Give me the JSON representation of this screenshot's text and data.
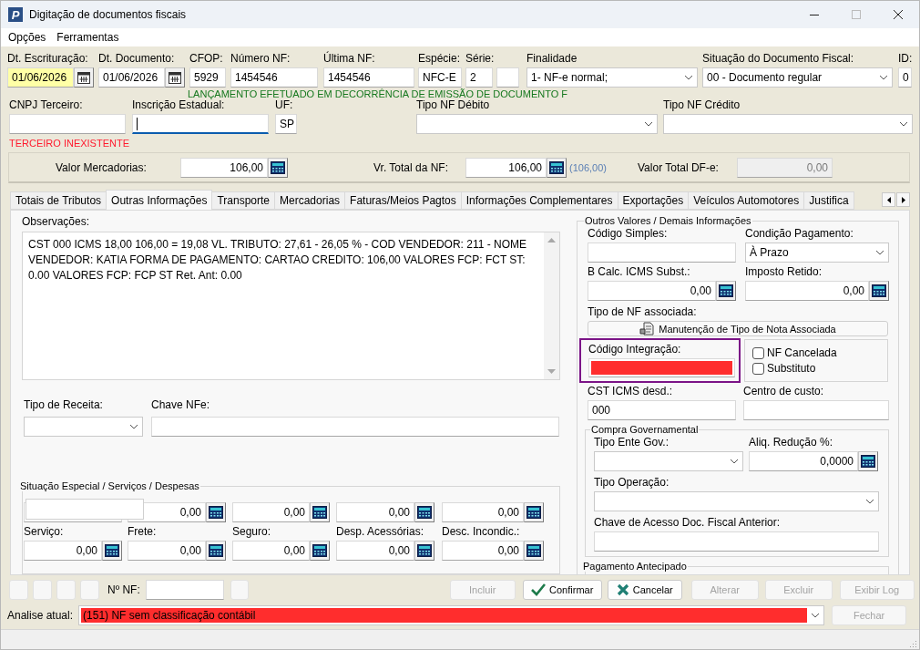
{
  "window": {
    "title": "Digitação de documentos fiscais",
    "logo": "P"
  },
  "menu": [
    {
      "label": "Opções"
    },
    {
      "label": "Ferramentas"
    }
  ],
  "header": [
    {
      "label": "Dt. Escrituração:",
      "value": "01/06/2026",
      "kind": "date",
      "highlighted": true
    },
    {
      "label": "Dt. Documento:",
      "value": "01/06/2026",
      "kind": "date",
      "highlighted": false
    },
    {
      "label": "CFOP:",
      "value": "5929",
      "kind": "text"
    },
    {
      "label": "Número NF:",
      "value": "1454546",
      "kind": "text"
    },
    {
      "label": "Última NF:",
      "value": "1454546",
      "kind": "text"
    },
    {
      "label": "Espécie:",
      "value": "NFC-E",
      "kind": "text"
    },
    {
      "label": "Série:",
      "value": "2",
      "kind": "text"
    },
    {
      "kind": "text"
    },
    {
      "label": "Finalidade",
      "value": "1- NF-e normal;",
      "kind": "select"
    },
    {
      "label": "Situação do Documento Fiscal:",
      "value": "00 - Documento regular",
      "kind": "select"
    },
    {
      "label": "ID:",
      "value": "0",
      "kind": "text"
    }
  ],
  "notice": "LANÇAMENTO EFETUADO EM DECORRÊNCIA DE EMISSÃO DE DOCUMENTO F",
  "party": [
    {
      "label": "CNPJ Terceiro:",
      "kind": "text"
    },
    {
      "label": "Inscrição Estadual:",
      "kind": "text",
      "focused": true
    },
    {
      "label": "UF:",
      "value": "SP",
      "kind": "text"
    },
    {
      "label": "Tipo NF Débito",
      "kind": "select"
    },
    {
      "label": "Tipo NF Crédito",
      "kind": "select"
    }
  ],
  "party_error": "TERCEIRO INEXISTENTE",
  "totals": [
    {
      "label": "Valor Mercadorias:",
      "value": "106,00",
      "kind": "calc",
      "disabled": false
    },
    {
      "label": "Vr. Total da NF:",
      "value": "106,00",
      "kind": "calc",
      "note": "(106,00)",
      "disabled": false
    },
    {
      "label": "Valor Total DF-e:",
      "value": "0,00",
      "kind": "text",
      "disabled": true
    }
  ],
  "tabs": [
    {
      "label": "Totais de Tributos",
      "selected": false
    },
    {
      "label": "Outras Informações",
      "selected": true
    },
    {
      "label": "Transporte",
      "selected": false
    },
    {
      "label": "Mercadorias",
      "selected": false
    },
    {
      "label": "Faturas/Meios Pagtos",
      "selected": false
    },
    {
      "label": "Informações Complementares",
      "selected": false
    },
    {
      "label": "Exportações",
      "selected": false
    },
    {
      "label": "Veículos Automotores",
      "selected": false
    },
    {
      "label": "Justifica",
      "selected": false
    }
  ],
  "observations": {
    "label": "Observações:",
    "value": "CST 000 ICMS 18,00 106,00 = 19,08 VL. TRIBUTO: 27,61 - 26,05 % - COD VENDEDOR: 211 - NOME VENDEDOR: KATIA FORMA DE PAGAMENTO: CARTAO CREDITO: 106,00 VALORES FCP: FCT ST: 0.00 VALORES FCP: FCP ST Ret. Ant: 0.00"
  },
  "tipo_receita": {
    "label": "Tipo de Receita:"
  },
  "chave_nfe": {
    "label": "Chave NFe:"
  },
  "special": {
    "title": "Situação Especial / Serviços / Despesas",
    "top_fields": [
      {
        "kind": "text"
      },
      {
        "kind": "calc",
        "value": "0,00"
      },
      {
        "kind": "calc",
        "value": "0,00"
      },
      {
        "kind": "calc",
        "value": "0,00"
      },
      {
        "kind": "calc",
        "value": "0,00"
      }
    ],
    "fields": [
      {
        "label": "Serviço:",
        "value": "0,00"
      },
      {
        "label": "Frete:",
        "value": "0,00"
      },
      {
        "label": "Seguro:",
        "value": "0,00"
      },
      {
        "label": "Desp. Acessórias:",
        "value": "0,00"
      },
      {
        "label": "Desc. Incondic.:",
        "value": "0,00"
      }
    ]
  },
  "other": {
    "title": "Outros Valores / Demais Informações",
    "codigo_simples": {
      "label": "Código Simples:"
    },
    "condicao_pagamento": {
      "label": "Condição Pagamento:",
      "value": "À Prazo"
    },
    "b_calc": {
      "label": "B Calc. ICMS Subst.:",
      "value": "0,00"
    },
    "imposto_retido": {
      "label": "Imposto Retido:",
      "value": "0,00"
    },
    "tipo_nf_associada": {
      "label": "Tipo de NF associada:",
      "button": "Manutenção de Tipo de Nota Associada"
    },
    "codigo_integracao": {
      "label": "Código Integração:",
      "alert": true,
      "highlighted": true
    },
    "checks": [
      {
        "label": "NF Cancelada",
        "checked": false
      },
      {
        "label": "Substituto",
        "checked": false
      }
    ],
    "cst": {
      "label": "CST ICMS desd.:",
      "value": "000"
    },
    "centro_custo": {
      "label": "Centro de custo:"
    },
    "compra_gov": {
      "title": "Compra Governamental",
      "tipo_ente": {
        "label": "Tipo Ente Gov.:"
      },
      "aliq": {
        "label": "Aliq. Redução %:",
        "value": "0,0000"
      },
      "tipo_operacao": {
        "label": "Tipo Operação:"
      },
      "chave_acesso": {
        "label": "Chave de Acesso Doc. Fiscal Anterior:"
      }
    },
    "pagamento_antecipado": {
      "title": "Pagamento Antecipado"
    }
  },
  "footer": {
    "tool_buttons": [
      {
        "disabled": true
      },
      {
        "disabled": true
      },
      {
        "disabled": true
      },
      {
        "disabled": true
      }
    ],
    "nf_label": "Nº NF:",
    "nf_button": {
      "disabled": true
    },
    "buttons": [
      {
        "label": "Incluir",
        "kind": "plain",
        "disabled": true
      },
      {
        "label": "Confirmar",
        "kind": "confirm",
        "disabled": false
      },
      {
        "label": "Cancelar",
        "kind": "cancel",
        "disabled": false
      },
      {
        "label": "Alterar",
        "kind": "plain",
        "disabled": true
      },
      {
        "label": "Excluir",
        "kind": "plain",
        "disabled": true
      },
      {
        "label": "Exibir Log",
        "kind": "plain",
        "disabled": true
      }
    ],
    "analysis": {
      "label": "Analise atual:",
      "value": "(151) NF sem classificação contábil",
      "alert": true
    },
    "close_button": {
      "label": "Fechar",
      "disabled": true
    }
  }
}
